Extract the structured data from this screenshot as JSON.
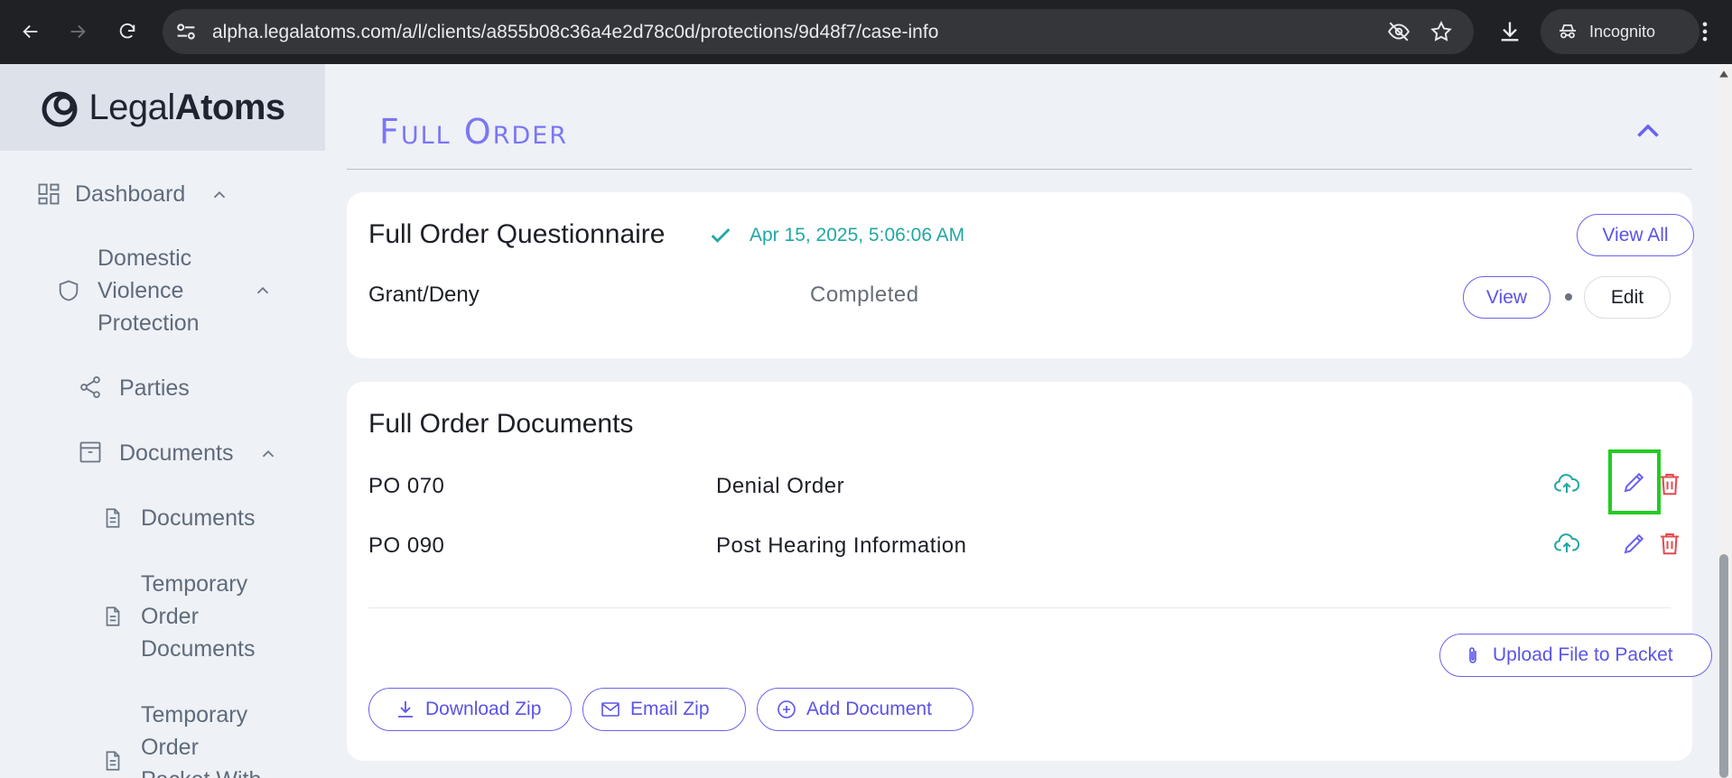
{
  "browser": {
    "url": "alpha.legalatoms.com/a/l/clients/a855b08c36a4e2d78c0d/protections/9d48f7/case-info",
    "profile_label": "Incognito"
  },
  "sidebar": {
    "logo_part1": "Legal",
    "logo_part2": "Atoms",
    "items": [
      {
        "label": "Dashboard"
      },
      {
        "label_lines": [
          "Domestic",
          "Violence",
          "Protection"
        ]
      },
      {
        "label": "Parties"
      },
      {
        "label": "Documents"
      },
      {
        "label": "Documents"
      },
      {
        "label_lines": [
          "Temporary",
          "Order",
          "Documents"
        ]
      },
      {
        "label_lines": [
          "Temporary",
          "Order",
          "Packet With"
        ]
      }
    ]
  },
  "section": {
    "title": "Full Order"
  },
  "questionnaire": {
    "title": "Full Order Questionnaire",
    "completed_at": "Apr 15, 2025, 5:06:06 AM",
    "view_all_label": "View All",
    "rows": [
      {
        "label": "Grant/Deny",
        "status": "Completed",
        "view_label": "View",
        "edit_label": "Edit"
      }
    ]
  },
  "documents": {
    "title": "Full Order Documents",
    "rows": [
      {
        "code": "PO 070",
        "name": "Denial Order"
      },
      {
        "code": "PO 090",
        "name": "Post Hearing Information"
      }
    ],
    "upload_label": "Upload File to Packet",
    "download_zip_label": "Download Zip",
    "email_zip_label": "Email Zip",
    "add_document_label": "Add Document"
  },
  "colors": {
    "accent": "#6962ef",
    "teal": "#21a7a3",
    "danger": "#e5484d",
    "highlight": "#22cc22"
  }
}
